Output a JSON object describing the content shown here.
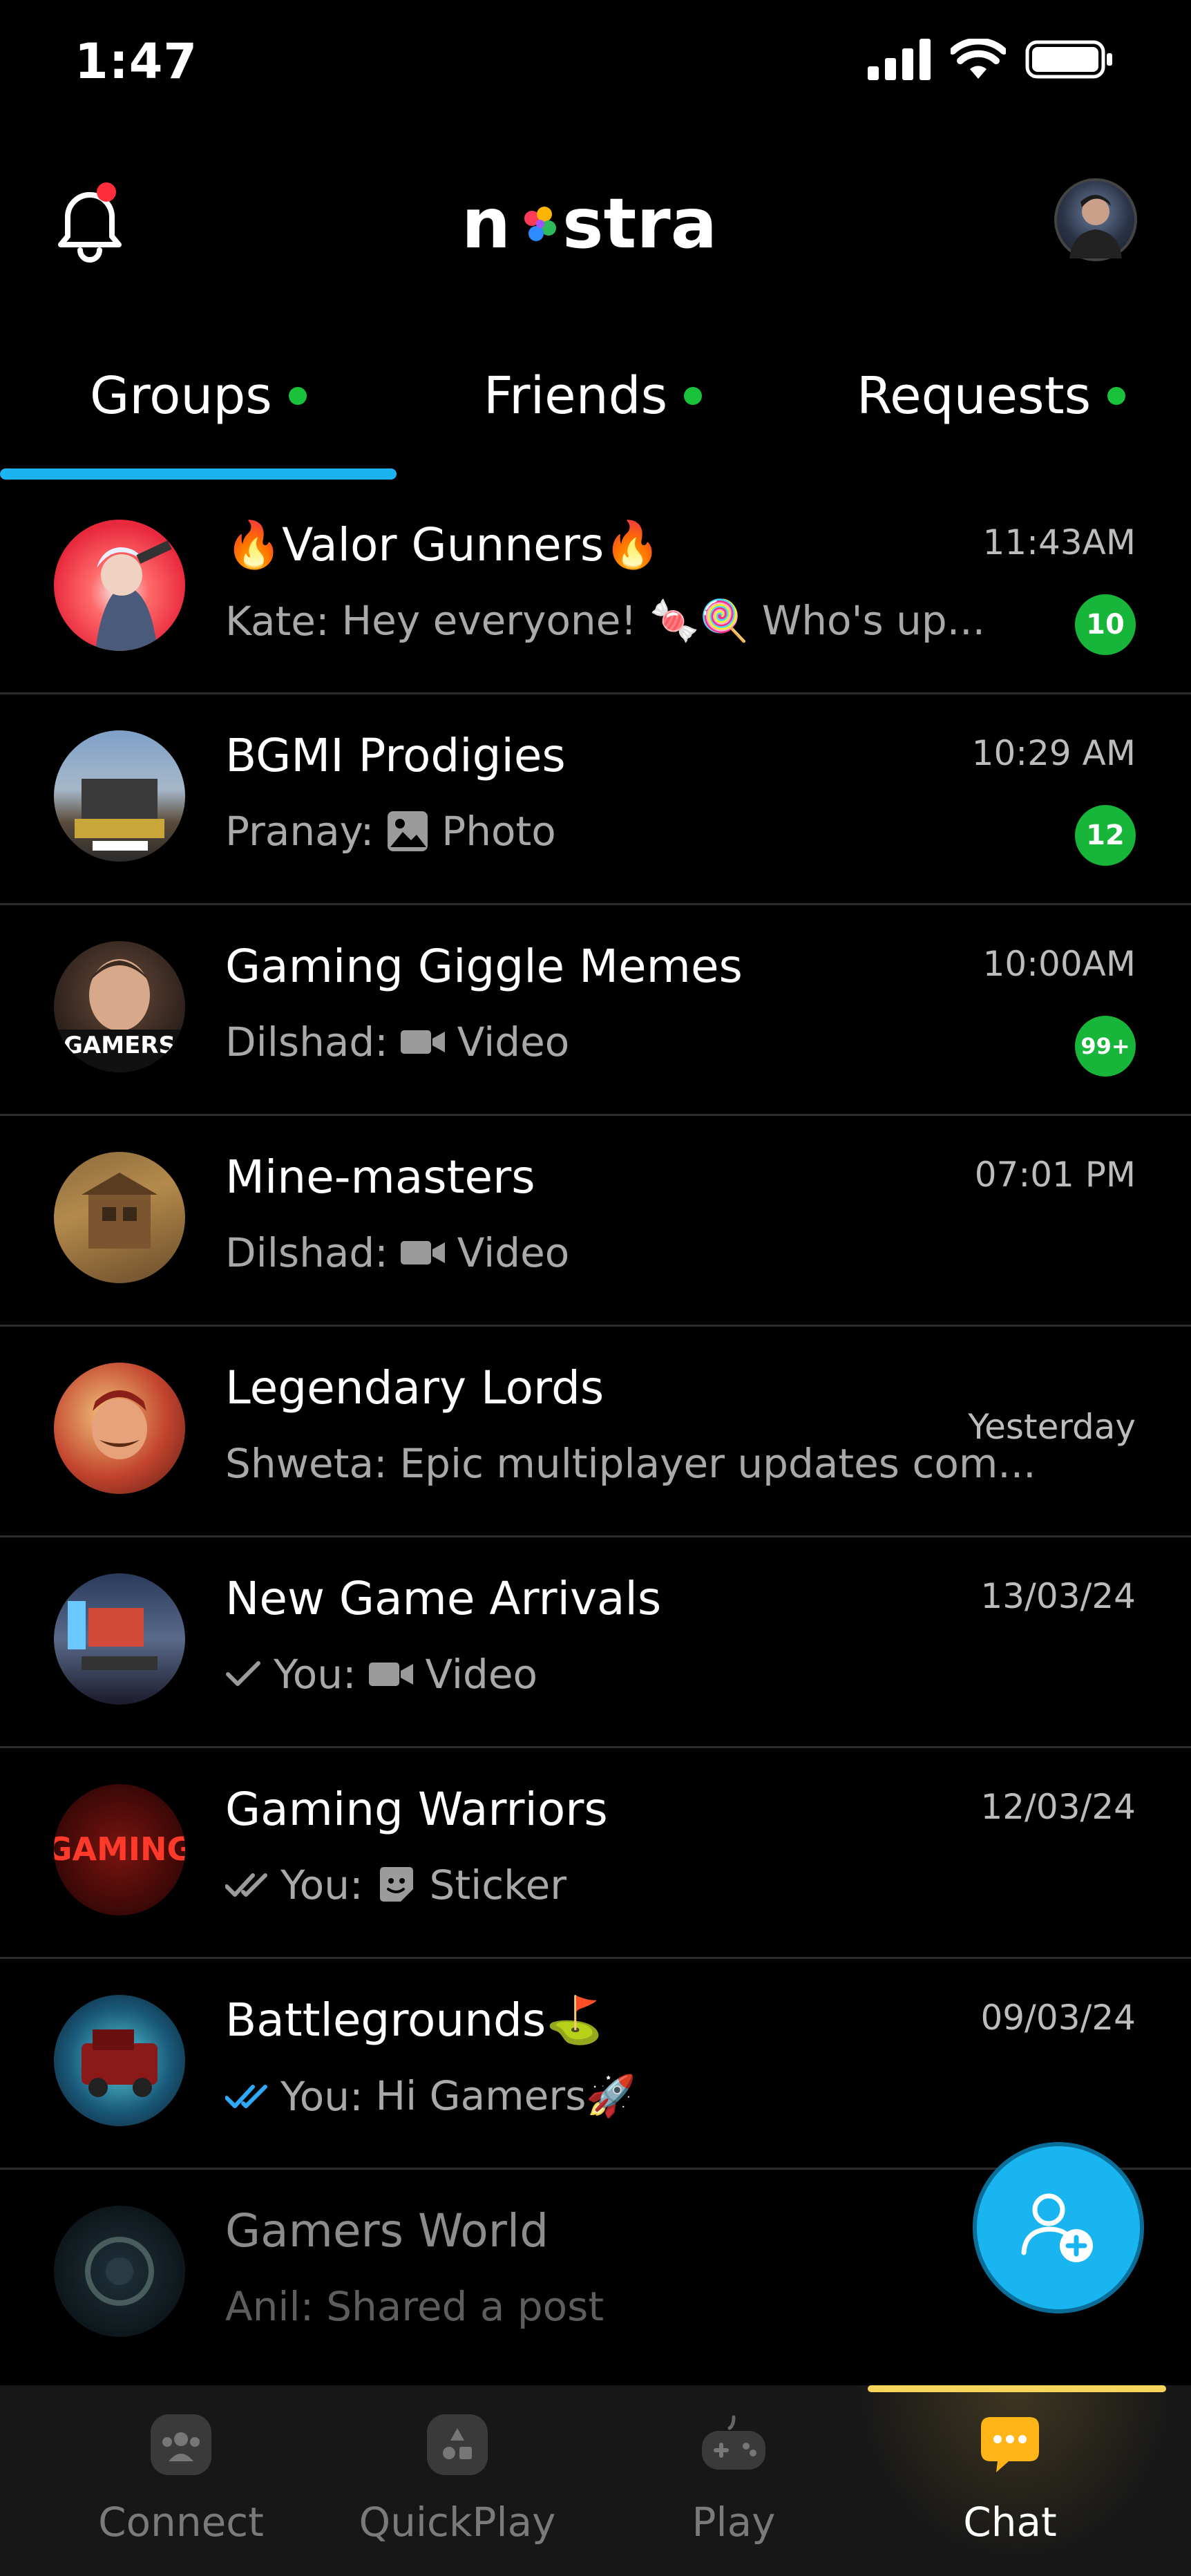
{
  "status": {
    "time": "1:47"
  },
  "header": {
    "logo_text": "nostra"
  },
  "tabs": [
    {
      "label": "Groups",
      "active": true
    },
    {
      "label": "Friends",
      "active": false
    },
    {
      "label": "Requests",
      "active": false
    }
  ],
  "chats": [
    {
      "name": "🔥Valor Gunners🔥",
      "sender": "Kate:",
      "message": "Hey everyone! 🍬🍭 Who's up...",
      "time": "11:43AM",
      "badge": "10",
      "avatar": "valor"
    },
    {
      "name": "BGMI Prodigies",
      "sender": "Pranay:",
      "message": "Photo",
      "media": "photo-icon",
      "time": "10:29 AM",
      "badge": "12",
      "avatar": "bgmi"
    },
    {
      "name": "Gaming Giggle Memes",
      "sender": "Dilshad:",
      "message": "Video",
      "media": "video-icon",
      "time": "10:00AM",
      "badge": "99+",
      "avatar": "gamers"
    },
    {
      "name": "Mine-masters",
      "sender": "Dilshad:",
      "message": "Video",
      "media": "video-icon",
      "time": "07:01 PM",
      "avatar": "mine"
    },
    {
      "name": "Legendary Lords",
      "sender": "Shweta:",
      "message": "Epic multiplayer updates com...",
      "time": "Yesterday",
      "avatar": "lords"
    },
    {
      "name": "New Game Arrivals",
      "sender": "You:",
      "message": "Video",
      "media": "video-icon",
      "tick": "single-check-icon",
      "time": "13/03/24",
      "avatar": "arrivals"
    },
    {
      "name": "Gaming Warriors",
      "sender": "You:",
      "message": "Sticker",
      "media": "sticker-icon",
      "tick": "double-check-icon",
      "time": "12/03/24",
      "avatar": "warriors"
    },
    {
      "name": "Battlegrounds⛳",
      "sender": "You:",
      "message": "Hi Gamers🚀",
      "tick": "double-check-blue-icon",
      "time": "09/03/24",
      "avatar": "battle"
    },
    {
      "name": "Gamers World",
      "sender": "Anil:",
      "message": "Shared a post",
      "time": "",
      "avatar": "world"
    }
  ],
  "fab": {
    "icon": "add-group-icon"
  },
  "bottom_nav": [
    {
      "label": "Connect",
      "icon": "people-icon"
    },
    {
      "label": "QuickPlay",
      "icon": "quickplay-icon"
    },
    {
      "label": "Play",
      "icon": "gamepad-icon"
    },
    {
      "label": "Chat",
      "icon": "chat-bubble-icon",
      "active": true
    }
  ],
  "colors": {
    "accent_blue": "#1cb3f2",
    "badge_green": "#17b53a",
    "nav_active": "#f7d45b"
  }
}
